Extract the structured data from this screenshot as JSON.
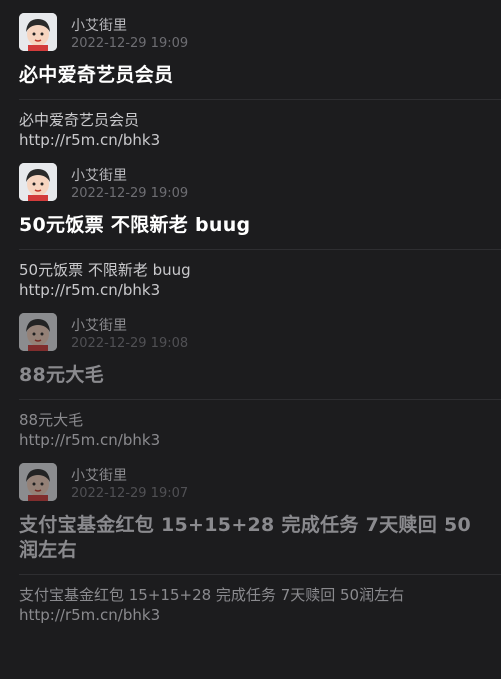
{
  "posts": [
    {
      "author": "小艾街里",
      "time": "2022-12-29 19:09",
      "title": "必中爱奇艺员会员",
      "body": "必中爱奇艺员会员",
      "link": "http://r5m.cn/bhk3"
    },
    {
      "author": "小艾街里",
      "time": "2022-12-29 19:09",
      "title": "50元饭票 不限新老 buug",
      "body": "50元饭票 不限新老 buug",
      "link": "http://r5m.cn/bhk3"
    },
    {
      "author": "小艾街里",
      "time": "2022-12-29 19:08",
      "title": "88元大毛",
      "body": "88元大毛",
      "link": "http://r5m.cn/bhk3"
    },
    {
      "author": "小艾街里",
      "time": "2022-12-29 19:07",
      "title": "支付宝基金红包 15+15+28 完成任务 7天赎回 50润左右",
      "body": "支付宝基金红包 15+15+28 完成任务 7天赎回 50润左右",
      "link": "http://r5m.cn/bhk3"
    }
  ],
  "colors": {
    "background": "#1c1c1e",
    "title": "#ffffff",
    "muted": "#8a8a8e",
    "divider": "#2e2e31"
  }
}
